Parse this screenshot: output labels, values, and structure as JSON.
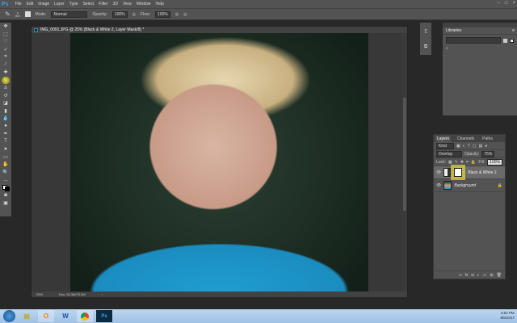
{
  "app": {
    "logo": "Ps",
    "menu": [
      "File",
      "Edit",
      "Image",
      "Layer",
      "Type",
      "Select",
      "Filter",
      "3D",
      "View",
      "Window",
      "Help"
    ]
  },
  "options": {
    "brush_size": "300",
    "mode_label": "Mode:",
    "mode": "Normal",
    "opacity_label": "Opacity:",
    "opacity": "100%",
    "flow_label": "Flow:",
    "flow": "100%"
  },
  "document": {
    "title": "IMG_0091.JPG @ 25% (Black & White 2, Layer Mask/8) *",
    "zoom": "25%",
    "doc_info": "Doc: 63.3M/73.3M"
  },
  "libraries": {
    "title": "Libraries"
  },
  "layers_panel": {
    "tabs": [
      "Layers",
      "Channels",
      "Paths"
    ],
    "kind": "Kind",
    "blend_mode": "Overlay",
    "opacity_label": "Opacity:",
    "opacity": "75%",
    "lock_label": "Lock:",
    "fill_label": "Fill:",
    "fill": "100%",
    "layers": [
      {
        "name": "Black & White 2"
      },
      {
        "name": "Background"
      }
    ]
  },
  "taskbar": {
    "time": "3:52 PM",
    "date": "8/6/2017"
  },
  "colors": {
    "accent": "#3aa0f0",
    "panel": "#535353"
  }
}
